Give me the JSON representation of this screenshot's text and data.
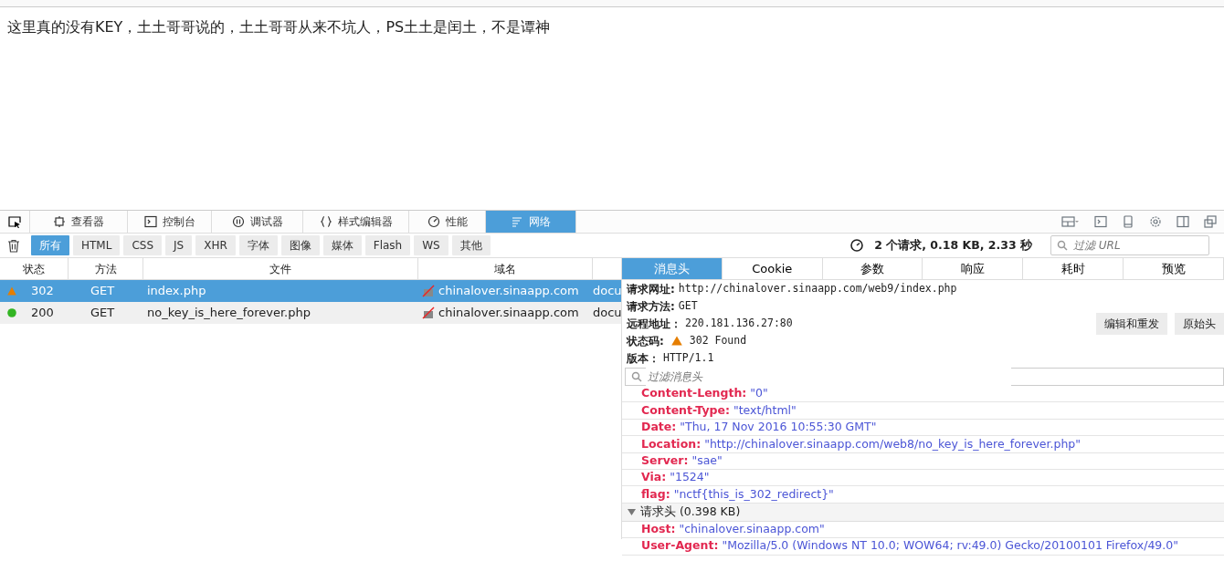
{
  "page_text": "这里真的没有KEY，土土哥哥说的，土土哥哥从来不坑人，PS土土是闰土，不是谭神",
  "devtools_tabs": [
    {
      "label": "查看器",
      "selected": false
    },
    {
      "label": "控制台",
      "selected": false
    },
    {
      "label": "调试器",
      "selected": false
    },
    {
      "label": "样式编辑器",
      "selected": false
    },
    {
      "label": "性能",
      "selected": false
    },
    {
      "label": "网络",
      "selected": true
    }
  ],
  "filters": [
    {
      "label": "所有",
      "selected": true
    },
    {
      "label": "HTML",
      "selected": false
    },
    {
      "label": "CSS",
      "selected": false
    },
    {
      "label": "JS",
      "selected": false
    },
    {
      "label": "XHR",
      "selected": false
    },
    {
      "label": "字体",
      "selected": false
    },
    {
      "label": "图像",
      "selected": false
    },
    {
      "label": "媒体",
      "selected": false
    },
    {
      "label": "Flash",
      "selected": false
    },
    {
      "label": "WS",
      "selected": false
    },
    {
      "label": "其他",
      "selected": false
    }
  ],
  "summary": "2 个请求, 0.18 KB, 2.33 秒",
  "url_filter": {
    "placeholder": "过滤 URL"
  },
  "table": {
    "columns": [
      "状态",
      "方法",
      "文件",
      "域名"
    ],
    "rows": [
      {
        "status": "302",
        "kind": "redirect",
        "method": "GET",
        "file": "index.php",
        "domain": "chinalover.sinaapp.com",
        "column_5": "docu",
        "selected": true
      },
      {
        "status": "200",
        "kind": "ok",
        "method": "GET",
        "file": "no_key_is_here_forever.php",
        "domain": "chinalover.sinaapp.com",
        "column_5": "docu",
        "selected": false
      }
    ]
  },
  "details": {
    "tabs": [
      {
        "label": "消息头",
        "selected": true
      },
      {
        "label": "Cookie",
        "selected": false
      },
      {
        "label": "参数",
        "selected": false
      },
      {
        "label": "响应",
        "selected": false
      },
      {
        "label": "耗时",
        "selected": false
      },
      {
        "label": "预览",
        "selected": false
      }
    ],
    "summary": [
      {
        "label": "请求网址:",
        "value": "http://chinalover.sinaapp.com/web9/index.php",
        "kind": "text"
      },
      {
        "label": "请求方法:",
        "value": "GET",
        "kind": "text"
      },
      {
        "label": "远程地址：",
        "value": "220.181.136.27:80",
        "kind": "text"
      },
      {
        "label": "状态码:",
        "value": "302 Found",
        "kind": "status"
      },
      {
        "label": "版本：",
        "value": "HTTP/1.1",
        "kind": "text"
      }
    ],
    "buttons": [
      "编辑和重发",
      "原始头"
    ],
    "header_filter": {
      "placeholder": "过滤消息头"
    },
    "response_headers": [
      {
        "name": "Content-Length:",
        "value": "\"0\""
      },
      {
        "name": "Content-Type:",
        "value": "\"text/html\""
      },
      {
        "name": "Date:",
        "value": "\"Thu, 17 Nov 2016 10:55:30 GMT\""
      },
      {
        "name": "Location:",
        "value": "\"http://chinalover.sinaapp.com/web8/no_key_is_here_forever.php\""
      },
      {
        "name": "Server:",
        "value": "\"sae\""
      },
      {
        "name": "Via:",
        "value": "\"1524\""
      },
      {
        "name": "flag:",
        "value": "\"nctf{this_is_302_redirect}\""
      }
    ],
    "request_section": {
      "label": "请求头 (0.398 KB)",
      "expanded": true
    },
    "request_headers": [
      {
        "name": "Host:",
        "value": "\"chinalover.sinaapp.com\""
      },
      {
        "name": "User-Agent:",
        "value": "\"Mozilla/5.0 (Windows NT 10.0; WOW64; rv:49.0) Gecko/20100101 Firefox/49.0\""
      }
    ]
  }
}
